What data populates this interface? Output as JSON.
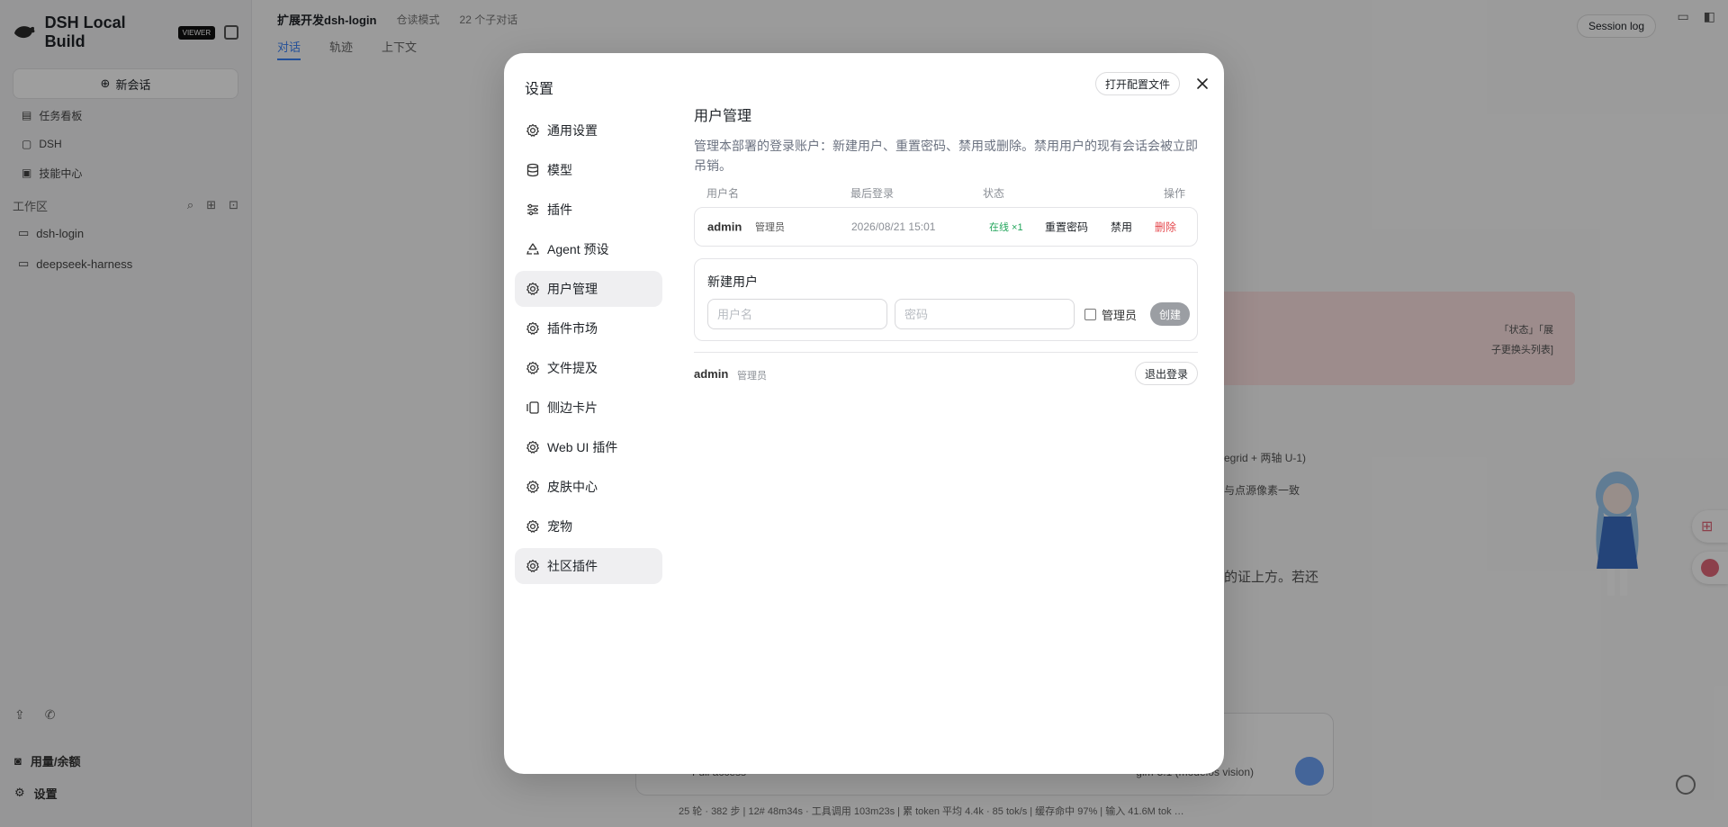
{
  "app": {
    "brand_name": "DSH Local Build",
    "brand_badge": "VIEWER",
    "new_chat": "新会话",
    "nav": [
      "任务看板",
      "DSH",
      "技能中心"
    ],
    "workspace_label": "工作区",
    "workspaces": [
      "dsh-login",
      "deepseek-harness"
    ],
    "bottom": [
      "用量/余额",
      "设置"
    ],
    "topbar_title": "扩展开发dsh-login",
    "topbar_mode": "仓读模式",
    "topbar_sub": "22 个子对话",
    "tabs": [
      "对话",
      "轨迹",
      "上下文"
    ],
    "session_log": "Session log",
    "composer_access": "Full access",
    "composer_model": "glm-5.1 (modelos vision)",
    "statusline": "25 轮 · 382 步 | 12# 48m34s · 工具调用 103m23s | 累 token 平均 4.4k · 85 tok/s | 缓存命中 97% | 输入 41.6M tok …",
    "bg_fragments": [
      "「状态」「展",
      "子更换头列表]",
      "egrid + 两轴 U-1)",
      "与点源像素一致",
      "的证上方。若还"
    ]
  },
  "settings": {
    "title": "设置",
    "open_config": "打开配置文件",
    "menu": [
      {
        "label": "通用设置",
        "icon": "gear-icon"
      },
      {
        "label": "模型",
        "icon": "database-icon"
      },
      {
        "label": "插件",
        "icon": "sliders-icon"
      },
      {
        "label": "Agent 预设",
        "icon": "recycle-icon"
      },
      {
        "label": "用户管理",
        "icon": "gear-icon",
        "active": true
      },
      {
        "label": "插件市场",
        "icon": "gear-icon"
      },
      {
        "label": "文件提及",
        "icon": "gear-icon"
      },
      {
        "label": "侧边卡片",
        "icon": "cards-icon"
      },
      {
        "label": "Web UI 插件",
        "icon": "gear-icon"
      },
      {
        "label": "皮肤中心",
        "icon": "gear-icon"
      },
      {
        "label": "宠物",
        "icon": "gear-icon"
      },
      {
        "label": "社区插件",
        "icon": "gear-icon",
        "hover": true
      }
    ],
    "section": {
      "title": "用户管理",
      "description": "管理本部署的登录账户：新建用户、重置密码、禁用或删除。禁用用户的现有会话会被立即吊销。",
      "columns": {
        "username": "用户名",
        "last_login": "最后登录",
        "status": "状态",
        "actions": "操作"
      },
      "users": [
        {
          "username": "admin",
          "role": "管理员",
          "last_login": "2026/08/21 15:01",
          "status": "在线 ×1",
          "actions": {
            "reset": "重置密码",
            "disable": "禁用",
            "delete": "删除"
          }
        }
      ],
      "new_user": {
        "title": "新建用户",
        "username_placeholder": "用户名",
        "password_placeholder": "密码",
        "admin_label": "管理员",
        "create_label": "创建"
      },
      "current_user": {
        "name": "admin",
        "role": "管理员",
        "logout": "退出登录"
      }
    }
  },
  "colors": {
    "accent": "#3b82f6",
    "online": "#22a55b",
    "danger": "#e5484d",
    "active_bg": "#efeff1"
  }
}
